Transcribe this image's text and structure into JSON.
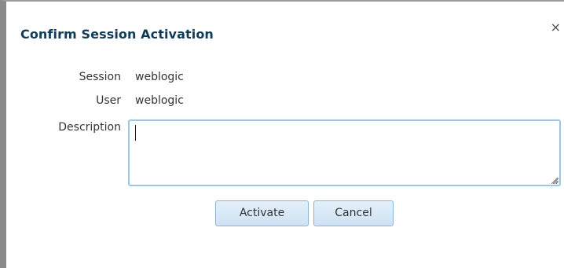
{
  "dialog": {
    "title": "Confirm Session Activation",
    "close_glyph": "×",
    "close_icon": "close-icon"
  },
  "fields": {
    "session_label": "Session",
    "session_value": "weblogic",
    "user_label": "User",
    "user_value": "weblogic",
    "description_label": "Description",
    "description_value": ""
  },
  "buttons": {
    "activate": "Activate",
    "cancel": "Cancel"
  },
  "colors": {
    "title": "#0f3b57",
    "textarea_border": "#9ec6e6",
    "button_border": "#8fb2d0",
    "button_fill": "#d9e9f7"
  }
}
